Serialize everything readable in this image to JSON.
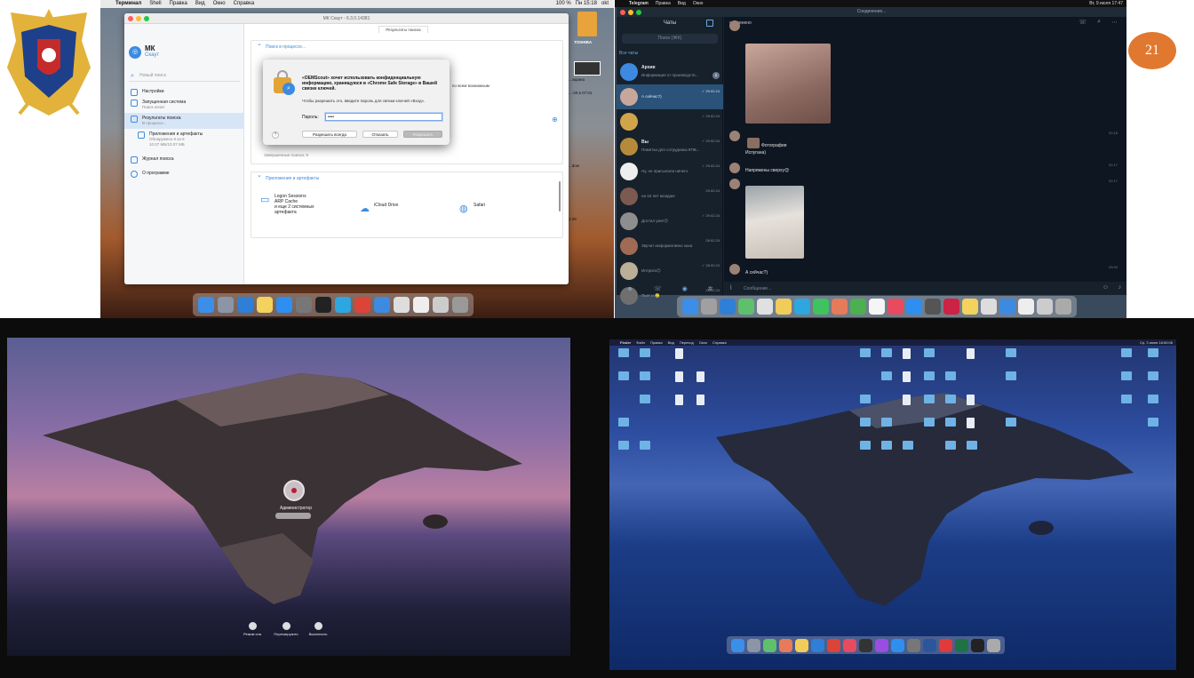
{
  "slide_number": "21",
  "top_left": {
    "menubar": {
      "app": "Терминал",
      "items": [
        "Shell",
        "Правка",
        "Вид",
        "Окно",
        "Справка"
      ],
      "status": "100 %",
      "clock": "Пн 15:18",
      "user": "okt"
    },
    "mk": {
      "window_title": "МК Скаут - 6.3.0.14381",
      "brand_name": "МК",
      "brand_sub": "Скаут",
      "new_search": "Новый поиск",
      "nav": [
        {
          "label": "Настройки",
          "sub": ""
        },
        {
          "label": "Запущенная система",
          "sub": "Поиск начат"
        },
        {
          "label": "Результаты поиска",
          "sub": "В процессе..."
        },
        {
          "label": "Приложения и артефакты",
          "sub": "Обнаружено 6 из 6"
        },
        {
          "label": "Журнал поиска",
          "sub": ""
        },
        {
          "label": "О программе",
          "sub": ""
        }
      ],
      "child_size": "10.07 МБ/10.07 МБ",
      "tab": "Результаты поиска",
      "box1_header": "Поиск в процессе...",
      "box1_text": "по всем возможным",
      "box1_footer": "Завершенные поиска: 9",
      "box2_header": "Приложения и артефакты",
      "artifacts": [
        {
          "label1": "Logon Sessions",
          "label2": "ARP Cache",
          "label3": "и еще 2 системных",
          "label4": "артефакта"
        },
        {
          "label1": "iCloud Drive"
        },
        {
          "label1": "Safari"
        }
      ]
    },
    "dialog": {
      "title": "«OEMScout» хочет использовать конфиденциальную информацию, хранящуюся в «Chrome Safe Storage» в Вашей связке ключей.",
      "desc": "Чтобы разрешить это, введите пароль для связки ключей «Вход».",
      "password_label": "Пароль:",
      "password_value": "••••",
      "btn_always": "Разрешать всегда",
      "btn_deny": "Отказать",
      "btn_allow": "Разрешить",
      "help": "?"
    },
    "edge": {
      "drive_label": "TOSHIBA",
      "texts": [
        "...экрана",
        "...-20 в 07:01",
        "...dow",
        "2:28"
      ]
    },
    "dock_colors": [
      "#3b8fe8",
      "#8b95a5",
      "#2f7fd6",
      "#f3d25e",
      "#2f8ff0",
      "#777777",
      "#222222",
      "#2ea6df",
      "#db4437",
      "#3d8be0",
      "#dddddd",
      "#eeeeee",
      "#cccccc",
      "#999999"
    ]
  },
  "top_right": {
    "menubar": {
      "app": "Telegram",
      "items": [
        "Правка",
        "Вид",
        "Окно"
      ],
      "clock": "Вт, 9 июля 17:47"
    },
    "title": "Соединение...",
    "chats_header": "Чаты",
    "search_placeholder": "Поиск (⌘K)",
    "folder": "Все чаты",
    "chats": [
      {
        "name": "Архив",
        "last": "Информация от производств...",
        "time": "",
        "badge": "2"
      },
      {
        "name": "",
        "last": "А сейчас?)",
        "time": "✓ 29.02.24",
        "badge": ""
      },
      {
        "name": "",
        "last": "",
        "time": "✓ 29.02.24",
        "badge": ""
      },
      {
        "name": "Вы",
        "last": "Памятка для сотрудника КПВ...",
        "time": "✓ 29.02.24",
        "badge": ""
      },
      {
        "name": "",
        "last": "Ну, не присылали ничего",
        "time": "✓ 29.02.24",
        "badge": ""
      },
      {
        "name": "",
        "last": "на 10 лет младше",
        "time": "29.02.24",
        "badge": ""
      },
      {
        "name": "",
        "last": "Достал уже!😊",
        "time": "✓ 29.02.24",
        "badge": ""
      },
      {
        "name": "",
        "last": "Звучит информативно хаха",
        "time": "28.02.24",
        "badge": ""
      },
      {
        "name": "",
        "last": "Интрига😉",
        "time": "✓ 28.02.24",
        "badge": ""
      },
      {
        "name": "",
        "last": "Пьет и 🥲",
        "time": "28.02.24",
        "badge": ""
      }
    ],
    "conv": {
      "header": "соединено",
      "caption1": "Фотография",
      "text1": "Испугана)",
      "text2": "Напряжены сверху😊",
      "text3": "А сейчас?)",
      "times": [
        "02:16",
        "02:17",
        "02:17",
        "03:34"
      ],
      "input_placeholder": "Сообщение..."
    },
    "dock_colors": [
      "#3b8fe8",
      "#a0a0a0",
      "#2f7fd6",
      "#5ec06c",
      "#e0e0e0",
      "#f2cc5a",
      "#2ea6df",
      "#3fc35f",
      "#e57b5b",
      "#4caf50",
      "#f5f5f5",
      "#e84a5f",
      "#2f8ff0",
      "#555555",
      "#cc2244",
      "#f3d25e",
      "#dddddd",
      "#3d8be0",
      "#eeeeee",
      "#cccccc",
      "#aaaaaa"
    ]
  },
  "bottom_left": {
    "user_name": "Администратор",
    "actions": [
      "Режим сна",
      "Перезагрузить",
      "Выключить"
    ]
  },
  "bottom_right": {
    "menubar": {
      "items": [
        "Finder",
        "Файл",
        "Правка",
        "Вид",
        "Переход",
        "Окно",
        "Справка"
      ],
      "clock": "Ср, 3 июня 18:50:06"
    },
    "dock_colors": [
      "#3b8fe8",
      "#8b95a5",
      "#5ec06c",
      "#e57b5b",
      "#f2cc5a",
      "#2f7fd6",
      "#db4437",
      "#e84a5f",
      "#333333",
      "#9a4de0",
      "#2f8ff0",
      "#777777",
      "#2b579a",
      "#e03a3a",
      "#1f7244",
      "#222222",
      "#aaaaaa"
    ]
  }
}
